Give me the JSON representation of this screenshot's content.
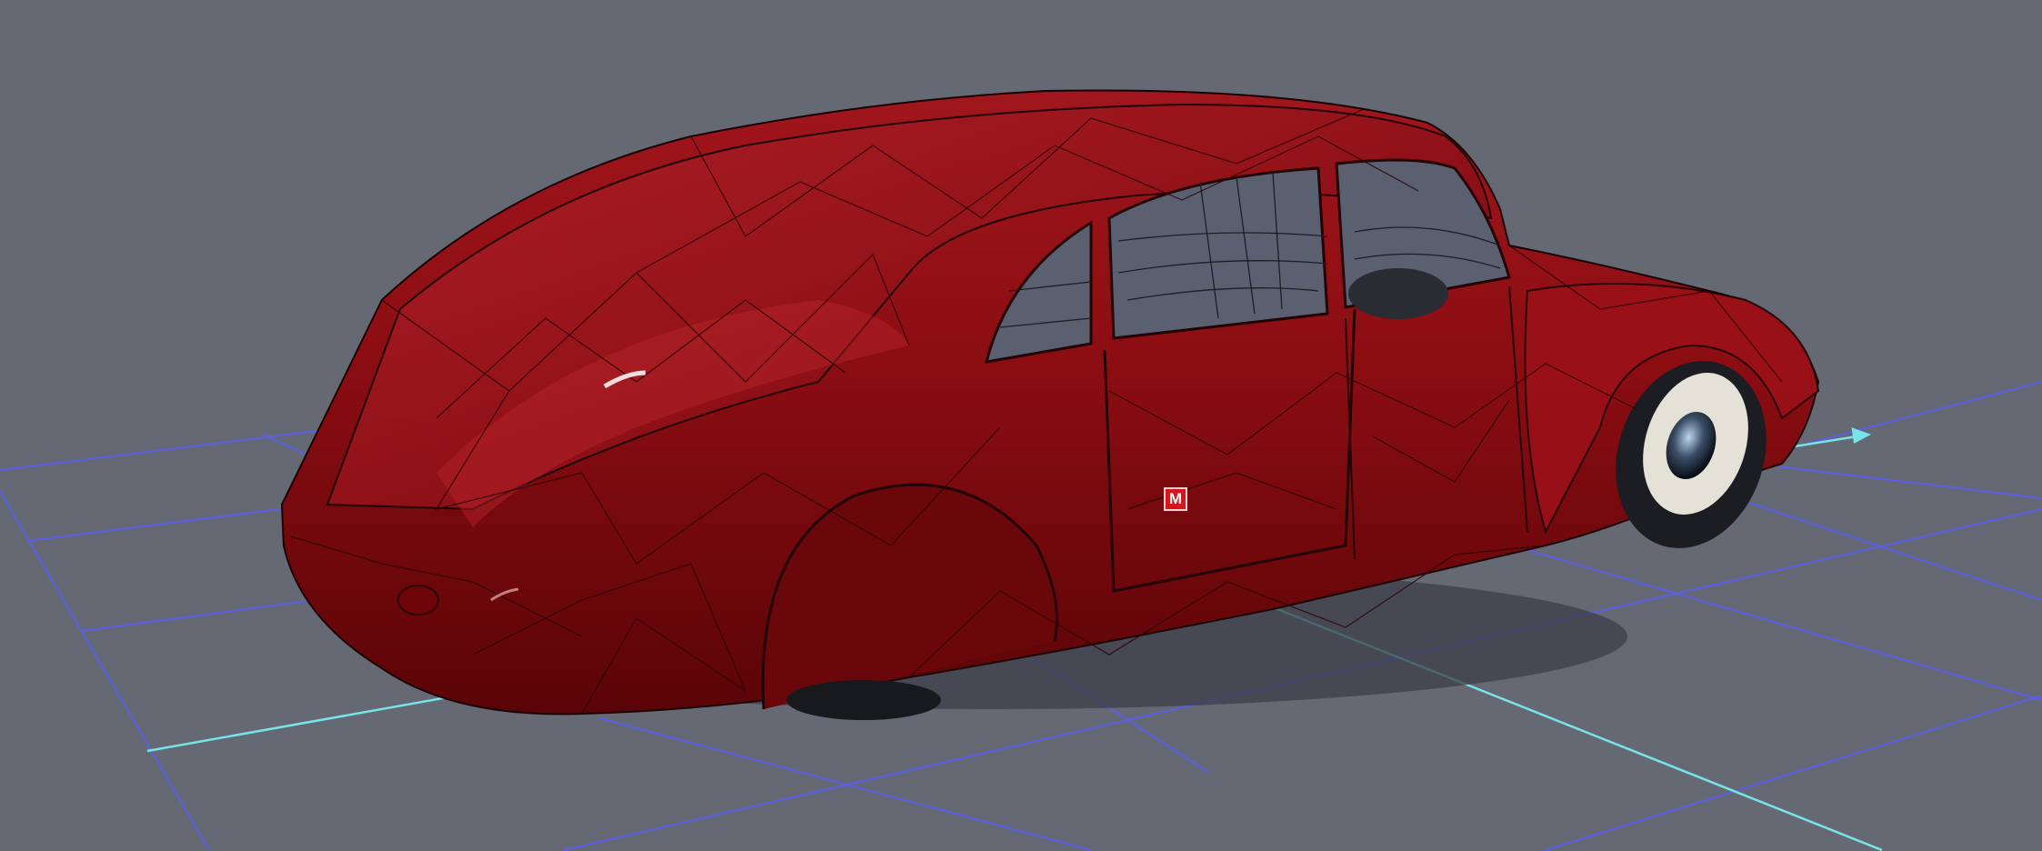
{
  "viewport": {
    "background": "#656973",
    "grid_color": "#5a5ee8",
    "axis_color": "#79e3e8",
    "model_color": "#8a0d12",
    "wireframe": true
  },
  "marker": {
    "label": "M",
    "icon": "material-marker-icon",
    "color": "#d9141a"
  }
}
